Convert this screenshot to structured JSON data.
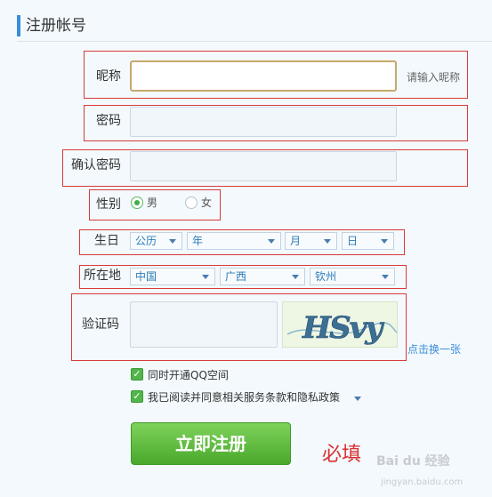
{
  "page": {
    "title": "注册帐号"
  },
  "form": {
    "nickname": {
      "label": "昵称",
      "value": "",
      "hint": "请输入昵称"
    },
    "password": {
      "label": "密码",
      "value": ""
    },
    "confirm_password": {
      "label": "确认密码",
      "value": ""
    },
    "gender": {
      "label": "性别",
      "options": [
        "男",
        "女"
      ],
      "selected": "男"
    },
    "birthday": {
      "label": "生日",
      "calendar": "公历",
      "year": "年",
      "month": "月",
      "day": "日"
    },
    "location": {
      "label": "所在地",
      "country": "中国",
      "province": "广西",
      "city": "钦州"
    },
    "captcha": {
      "label": "验证码",
      "value": "",
      "image_text": "HSvy",
      "refresh_link": "点击换一张"
    },
    "agreements": [
      {
        "label": "同时开通QQ空间",
        "checked": true
      },
      {
        "label": "我已阅读并同意相关服务条款和隐私政策",
        "checked": true
      }
    ],
    "submit_label": "立即注册"
  },
  "annotation": {
    "text": "必填"
  },
  "watermark": {
    "brand": "Bai du 经验",
    "url": "jingyan.baidu.com"
  },
  "colors": {
    "accent": "#3b8dd8",
    "required_box": "#d93a3a",
    "submit": "#5bb53a"
  }
}
